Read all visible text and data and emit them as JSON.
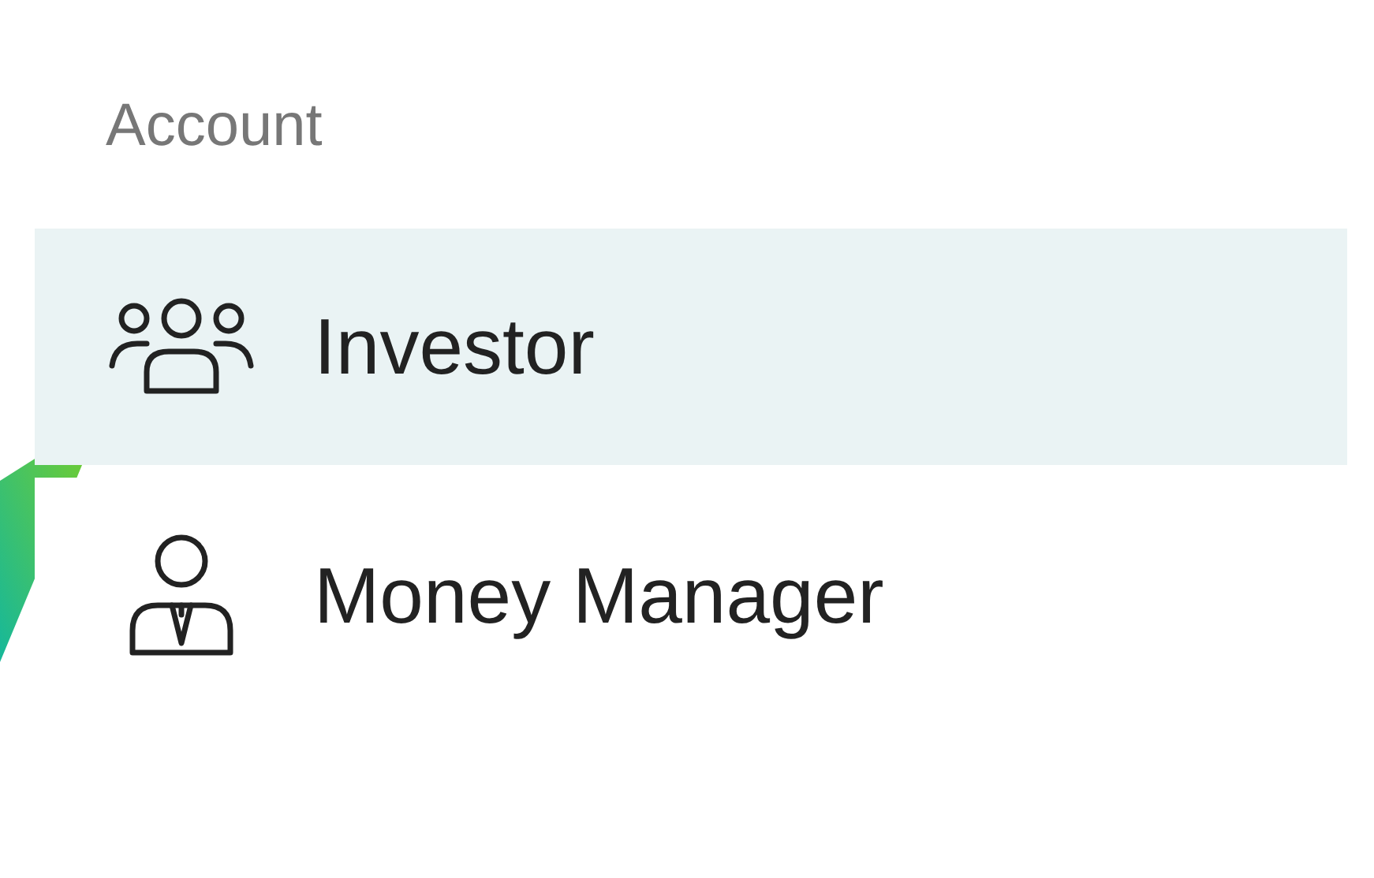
{
  "section": {
    "title": "Account"
  },
  "items": [
    {
      "label": "Investor",
      "kind": "group",
      "selected": true
    },
    {
      "label": "Money Manager",
      "kind": "manager",
      "selected": false
    }
  ]
}
